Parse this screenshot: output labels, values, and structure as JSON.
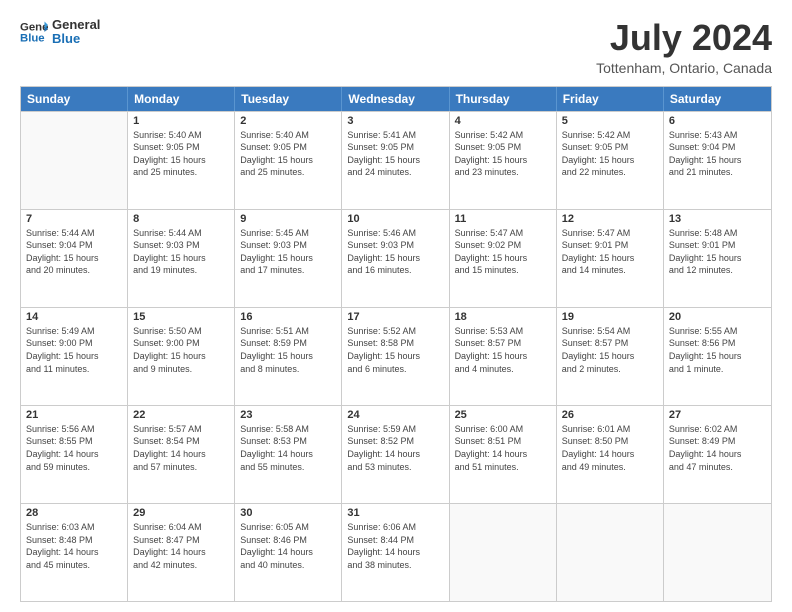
{
  "logo": {
    "line1": "General",
    "line2": "Blue"
  },
  "title": "July 2024",
  "location": "Tottenham, Ontario, Canada",
  "days_header": [
    "Sunday",
    "Monday",
    "Tuesday",
    "Wednesday",
    "Thursday",
    "Friday",
    "Saturday"
  ],
  "weeks": [
    [
      {
        "day": "",
        "info": ""
      },
      {
        "day": "1",
        "info": "Sunrise: 5:40 AM\nSunset: 9:05 PM\nDaylight: 15 hours\nand 25 minutes."
      },
      {
        "day": "2",
        "info": "Sunrise: 5:40 AM\nSunset: 9:05 PM\nDaylight: 15 hours\nand 25 minutes."
      },
      {
        "day": "3",
        "info": "Sunrise: 5:41 AM\nSunset: 9:05 PM\nDaylight: 15 hours\nand 24 minutes."
      },
      {
        "day": "4",
        "info": "Sunrise: 5:42 AM\nSunset: 9:05 PM\nDaylight: 15 hours\nand 23 minutes."
      },
      {
        "day": "5",
        "info": "Sunrise: 5:42 AM\nSunset: 9:05 PM\nDaylight: 15 hours\nand 22 minutes."
      },
      {
        "day": "6",
        "info": "Sunrise: 5:43 AM\nSunset: 9:04 PM\nDaylight: 15 hours\nand 21 minutes."
      }
    ],
    [
      {
        "day": "7",
        "info": "Sunrise: 5:44 AM\nSunset: 9:04 PM\nDaylight: 15 hours\nand 20 minutes."
      },
      {
        "day": "8",
        "info": "Sunrise: 5:44 AM\nSunset: 9:03 PM\nDaylight: 15 hours\nand 19 minutes."
      },
      {
        "day": "9",
        "info": "Sunrise: 5:45 AM\nSunset: 9:03 PM\nDaylight: 15 hours\nand 17 minutes."
      },
      {
        "day": "10",
        "info": "Sunrise: 5:46 AM\nSunset: 9:03 PM\nDaylight: 15 hours\nand 16 minutes."
      },
      {
        "day": "11",
        "info": "Sunrise: 5:47 AM\nSunset: 9:02 PM\nDaylight: 15 hours\nand 15 minutes."
      },
      {
        "day": "12",
        "info": "Sunrise: 5:47 AM\nSunset: 9:01 PM\nDaylight: 15 hours\nand 14 minutes."
      },
      {
        "day": "13",
        "info": "Sunrise: 5:48 AM\nSunset: 9:01 PM\nDaylight: 15 hours\nand 12 minutes."
      }
    ],
    [
      {
        "day": "14",
        "info": "Sunrise: 5:49 AM\nSunset: 9:00 PM\nDaylight: 15 hours\nand 11 minutes."
      },
      {
        "day": "15",
        "info": "Sunrise: 5:50 AM\nSunset: 9:00 PM\nDaylight: 15 hours\nand 9 minutes."
      },
      {
        "day": "16",
        "info": "Sunrise: 5:51 AM\nSunset: 8:59 PM\nDaylight: 15 hours\nand 8 minutes."
      },
      {
        "day": "17",
        "info": "Sunrise: 5:52 AM\nSunset: 8:58 PM\nDaylight: 15 hours\nand 6 minutes."
      },
      {
        "day": "18",
        "info": "Sunrise: 5:53 AM\nSunset: 8:57 PM\nDaylight: 15 hours\nand 4 minutes."
      },
      {
        "day": "19",
        "info": "Sunrise: 5:54 AM\nSunset: 8:57 PM\nDaylight: 15 hours\nand 2 minutes."
      },
      {
        "day": "20",
        "info": "Sunrise: 5:55 AM\nSunset: 8:56 PM\nDaylight: 15 hours\nand 1 minute."
      }
    ],
    [
      {
        "day": "21",
        "info": "Sunrise: 5:56 AM\nSunset: 8:55 PM\nDaylight: 14 hours\nand 59 minutes."
      },
      {
        "day": "22",
        "info": "Sunrise: 5:57 AM\nSunset: 8:54 PM\nDaylight: 14 hours\nand 57 minutes."
      },
      {
        "day": "23",
        "info": "Sunrise: 5:58 AM\nSunset: 8:53 PM\nDaylight: 14 hours\nand 55 minutes."
      },
      {
        "day": "24",
        "info": "Sunrise: 5:59 AM\nSunset: 8:52 PM\nDaylight: 14 hours\nand 53 minutes."
      },
      {
        "day": "25",
        "info": "Sunrise: 6:00 AM\nSunset: 8:51 PM\nDaylight: 14 hours\nand 51 minutes."
      },
      {
        "day": "26",
        "info": "Sunrise: 6:01 AM\nSunset: 8:50 PM\nDaylight: 14 hours\nand 49 minutes."
      },
      {
        "day": "27",
        "info": "Sunrise: 6:02 AM\nSunset: 8:49 PM\nDaylight: 14 hours\nand 47 minutes."
      }
    ],
    [
      {
        "day": "28",
        "info": "Sunrise: 6:03 AM\nSunset: 8:48 PM\nDaylight: 14 hours\nand 45 minutes."
      },
      {
        "day": "29",
        "info": "Sunrise: 6:04 AM\nSunset: 8:47 PM\nDaylight: 14 hours\nand 42 minutes."
      },
      {
        "day": "30",
        "info": "Sunrise: 6:05 AM\nSunset: 8:46 PM\nDaylight: 14 hours\nand 40 minutes."
      },
      {
        "day": "31",
        "info": "Sunrise: 6:06 AM\nSunset: 8:44 PM\nDaylight: 14 hours\nand 38 minutes."
      },
      {
        "day": "",
        "info": ""
      },
      {
        "day": "",
        "info": ""
      },
      {
        "day": "",
        "info": ""
      }
    ]
  ]
}
